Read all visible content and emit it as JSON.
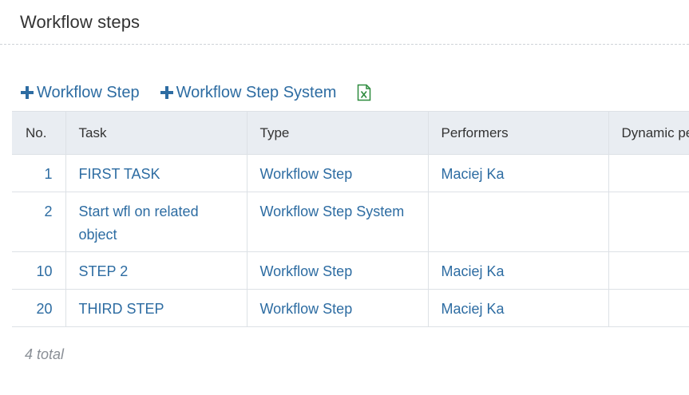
{
  "section": {
    "title": "Workflow steps"
  },
  "toolbar": {
    "add_step_label": "Workflow Step",
    "add_system_step_label": "Workflow Step System",
    "export_icon": "excel-export-icon"
  },
  "table": {
    "columns": [
      "No.",
      "Task",
      "Type",
      "Performers",
      "Dynamic pe"
    ],
    "rows": [
      {
        "no": "1",
        "task": "FIRST TASK",
        "type": "Workflow Step",
        "performers": "Maciej Ka",
        "dynamic": ""
      },
      {
        "no": "2",
        "task": "Start wfl on related object",
        "type": "Workflow Step System",
        "performers": "",
        "dynamic": ""
      },
      {
        "no": "10",
        "task": "STEP 2",
        "type": "Workflow Step",
        "performers": "Maciej Ka",
        "dynamic": ""
      },
      {
        "no": "20",
        "task": "THIRD STEP",
        "type": "Workflow Step",
        "performers": "Maciej Ka",
        "dynamic": ""
      }
    ]
  },
  "footer": {
    "total": "4 total"
  },
  "colors": {
    "link": "#2d6ca2",
    "header_bg": "#e9edf2",
    "excel_green": "#2e8b3e"
  }
}
